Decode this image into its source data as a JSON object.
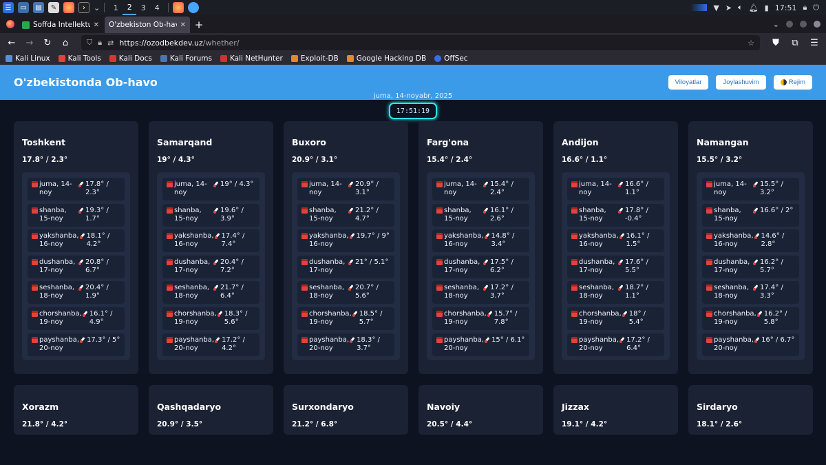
{
  "taskbar": {
    "workspaces": [
      "1",
      "2",
      "3",
      "4"
    ],
    "active_workspace": "2",
    "clock": "17:51"
  },
  "browser": {
    "tabs": [
      {
        "title": "Soffda Intellektual mulki"
      },
      {
        "title": "O'zbekiston Ob-havo"
      }
    ],
    "url_host": "https://ozodbekdev.uz",
    "url_path": "/whether/",
    "bookmarks": [
      "Kali Linux",
      "Kali Tools",
      "Kali Docs",
      "Kali Forums",
      "Kali NetHunter",
      "Exploit-DB",
      "Google Hacking DB",
      "OffSec"
    ]
  },
  "page": {
    "title": "O'zbekistonda Ob-havo",
    "buttons": {
      "regions": "Viloyatlar",
      "location": "Joylashuvim",
      "mode": "Rejim"
    },
    "date": "juma, 14-noyabr, 2025",
    "clock": "17:51:19"
  },
  "cities": [
    {
      "name": "Toshkent",
      "temp": "17.8° / 2.3°",
      "days": [
        {
          "date": "juma, 14-noy",
          "temp": "17.8° / 2.3°"
        },
        {
          "date": "shanba, 15-noy",
          "temp": "19.3° / 1.7°"
        },
        {
          "date": "yakshanba, 16-noy",
          "temp": "18.1° / 4.2°"
        },
        {
          "date": "dushanba, 17-noy",
          "temp": "20.8° / 6.7°"
        },
        {
          "date": "seshanba, 18-noy",
          "temp": "20.4° / 1.9°"
        },
        {
          "date": "chorshanba, 19-noy",
          "temp": "16.1° / 4.9°"
        },
        {
          "date": "payshanba, 20-noy",
          "temp": "17.3° / 5°"
        }
      ]
    },
    {
      "name": "Samarqand",
      "temp": "19° / 4.3°",
      "days": [
        {
          "date": "juma, 14-noy",
          "temp": "19° / 4.3°"
        },
        {
          "date": "shanba, 15-noy",
          "temp": "19.6° / 3.9°"
        },
        {
          "date": "yakshanba, 16-noy",
          "temp": "17.4° / 7.4°"
        },
        {
          "date": "dushanba, 17-noy",
          "temp": "20.4° / 7.2°"
        },
        {
          "date": "seshanba, 18-noy",
          "temp": "21.7° / 6.4°"
        },
        {
          "date": "chorshanba, 19-noy",
          "temp": "18.3° / 5.6°"
        },
        {
          "date": "payshanba, 20-noy",
          "temp": "17.2° / 4.2°"
        }
      ]
    },
    {
      "name": "Buxoro",
      "temp": "20.9° / 3.1°",
      "days": [
        {
          "date": "juma, 14-noy",
          "temp": "20.9° / 3.1°"
        },
        {
          "date": "shanba, 15-noy",
          "temp": "21.2° / 4.7°"
        },
        {
          "date": "yakshanba, 16-noy",
          "temp": "19.7° / 9°"
        },
        {
          "date": "dushanba, 17-noy",
          "temp": "21° / 5.1°"
        },
        {
          "date": "seshanba, 18-noy",
          "temp": "20.7° / 5.6°"
        },
        {
          "date": "chorshanba, 19-noy",
          "temp": "18.5° / 5.7°"
        },
        {
          "date": "payshanba, 20-noy",
          "temp": "18.3° / 3.7°"
        }
      ]
    },
    {
      "name": "Farg'ona",
      "temp": "15.4° / 2.4°",
      "days": [
        {
          "date": "juma, 14-noy",
          "temp": "15.4° / 2.4°"
        },
        {
          "date": "shanba, 15-noy",
          "temp": "16.1° / 2.6°"
        },
        {
          "date": "yakshanba, 16-noy",
          "temp": "14.8° / 3.4°"
        },
        {
          "date": "dushanba, 17-noy",
          "temp": "17.5° / 6.2°"
        },
        {
          "date": "seshanba, 18-noy",
          "temp": "17.2° / 3.7°"
        },
        {
          "date": "chorshanba, 19-noy",
          "temp": "15.7° / 7.8°"
        },
        {
          "date": "payshanba, 20-noy",
          "temp": "15° / 6.1°"
        }
      ]
    },
    {
      "name": "Andijon",
      "temp": "16.6° / 1.1°",
      "days": [
        {
          "date": "juma, 14-noy",
          "temp": "16.6° / 1.1°"
        },
        {
          "date": "shanba, 15-noy",
          "temp": "17.8° / -0.4°"
        },
        {
          "date": "yakshanba, 16-noy",
          "temp": "16.1° / 1.5°"
        },
        {
          "date": "dushanba, 17-noy",
          "temp": "17.6° / 5.5°"
        },
        {
          "date": "seshanba, 18-noy",
          "temp": "18.7° / 1.1°"
        },
        {
          "date": "chorshanba, 19-noy",
          "temp": "18° / 5.4°"
        },
        {
          "date": "payshanba, 20-noy",
          "temp": "17.2° / 6.4°"
        }
      ]
    },
    {
      "name": "Namangan",
      "temp": "15.5° / 3.2°",
      "days": [
        {
          "date": "juma, 14-noy",
          "temp": "15.5° / 3.2°"
        },
        {
          "date": "shanba, 15-noy",
          "temp": "16.6° / 2°"
        },
        {
          "date": "yakshanba, 16-noy",
          "temp": "14.6° / 2.8°"
        },
        {
          "date": "dushanba, 17-noy",
          "temp": "16.2° / 5.7°"
        },
        {
          "date": "seshanba, 18-noy",
          "temp": "17.4° / 3.3°"
        },
        {
          "date": "chorshanba, 19-noy",
          "temp": "16.2° / 5.8°"
        },
        {
          "date": "payshanba, 20-noy",
          "temp": "16° / 6.7°"
        }
      ]
    }
  ],
  "cities_row2": [
    {
      "name": "Xorazm",
      "temp": "21.8° / 4.2°"
    },
    {
      "name": "Qashqadaryo",
      "temp": "20.9° / 3.5°"
    },
    {
      "name": "Surxondaryo",
      "temp": "21.2° / 6.8°"
    },
    {
      "name": "Navoiy",
      "temp": "20.5° / 4.4°"
    },
    {
      "name": "Jizzax",
      "temp": "19.1° / 4.2°"
    },
    {
      "name": "Sirdaryo",
      "temp": "18.1° / 2.6°"
    }
  ],
  "colors": {
    "header": "#3b9be8",
    "background": "#0d1321",
    "card": "#1b2234",
    "clock_border": "#2ee6e6"
  }
}
